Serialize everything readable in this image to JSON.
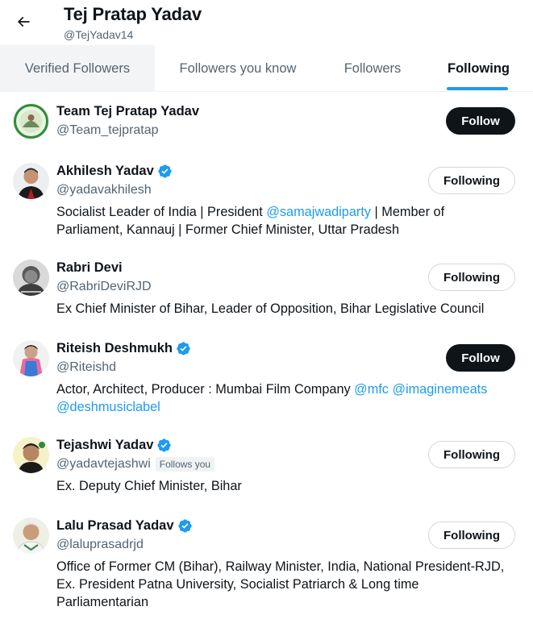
{
  "header": {
    "title": "Tej Pratap Yadav",
    "handle": "@TejYadav14",
    "back_icon": "arrow-left-icon"
  },
  "tabs": [
    {
      "label": "Verified Followers",
      "state": "hover"
    },
    {
      "label": "Followers you know",
      "state": "normal"
    },
    {
      "label": "Followers",
      "state": "normal"
    },
    {
      "label": "Following",
      "state": "active"
    }
  ],
  "colors": {
    "accent": "#1d9bf0",
    "text_primary": "#0f1419",
    "text_secondary": "#536471",
    "follow_button": "#0f1419"
  },
  "users": [
    {
      "name": "Team Tej Pratap Yadav",
      "handle": "@Team_tejpratap",
      "verified": false,
      "follows_you": false,
      "button": "Follow",
      "bio": []
    },
    {
      "name": "Akhilesh Yadav",
      "handle": "@yadavakhilesh",
      "verified": true,
      "follows_you": false,
      "button": "Following",
      "bio": [
        {
          "text": "Socialist Leader of India | President "
        },
        {
          "text": "@samajwadiparty",
          "mention": true
        },
        {
          "text": " | Member of Parliament, Kannauj | Former Chief Minister, Uttar Pradesh"
        }
      ]
    },
    {
      "name": "Rabri Devi",
      "handle": "@RabriDeviRJD",
      "verified": false,
      "follows_you": false,
      "button": "Following",
      "bio": [
        {
          "text": "Ex Chief Minister of Bihar, Leader of Opposition, Bihar Legislative Council"
        }
      ]
    },
    {
      "name": "Riteish Deshmukh",
      "handle": "@Riteishd",
      "verified": true,
      "follows_you": false,
      "button": "Follow",
      "bio": [
        {
          "text": "Actor, Architect, Producer : Mumbai Film Company "
        },
        {
          "text": "@mfc",
          "mention": true
        },
        {
          "text": " "
        },
        {
          "text": "@imaginemeats",
          "mention": true
        },
        {
          "text": " "
        },
        {
          "text": "@deshmusiclabel",
          "mention": true
        }
      ]
    },
    {
      "name": "Tejashwi Yadav",
      "handle": "@yadavtejashwi",
      "verified": true,
      "follows_you": true,
      "follows_you_label": "Follows you",
      "button": "Following",
      "bio": [
        {
          "text": "Ex. Deputy Chief Minister, Bihar"
        }
      ]
    },
    {
      "name": "Lalu Prasad Yadav",
      "handle": "@laluprasadrjd",
      "verified": true,
      "follows_you": false,
      "button": "Following",
      "bio": [
        {
          "text": "Office of Former CM (Bihar), Railway Minister, India, National President-RJD, Ex. President Patna University, Socialist Patriarch & Long time Parliamentarian"
        }
      ]
    }
  ]
}
